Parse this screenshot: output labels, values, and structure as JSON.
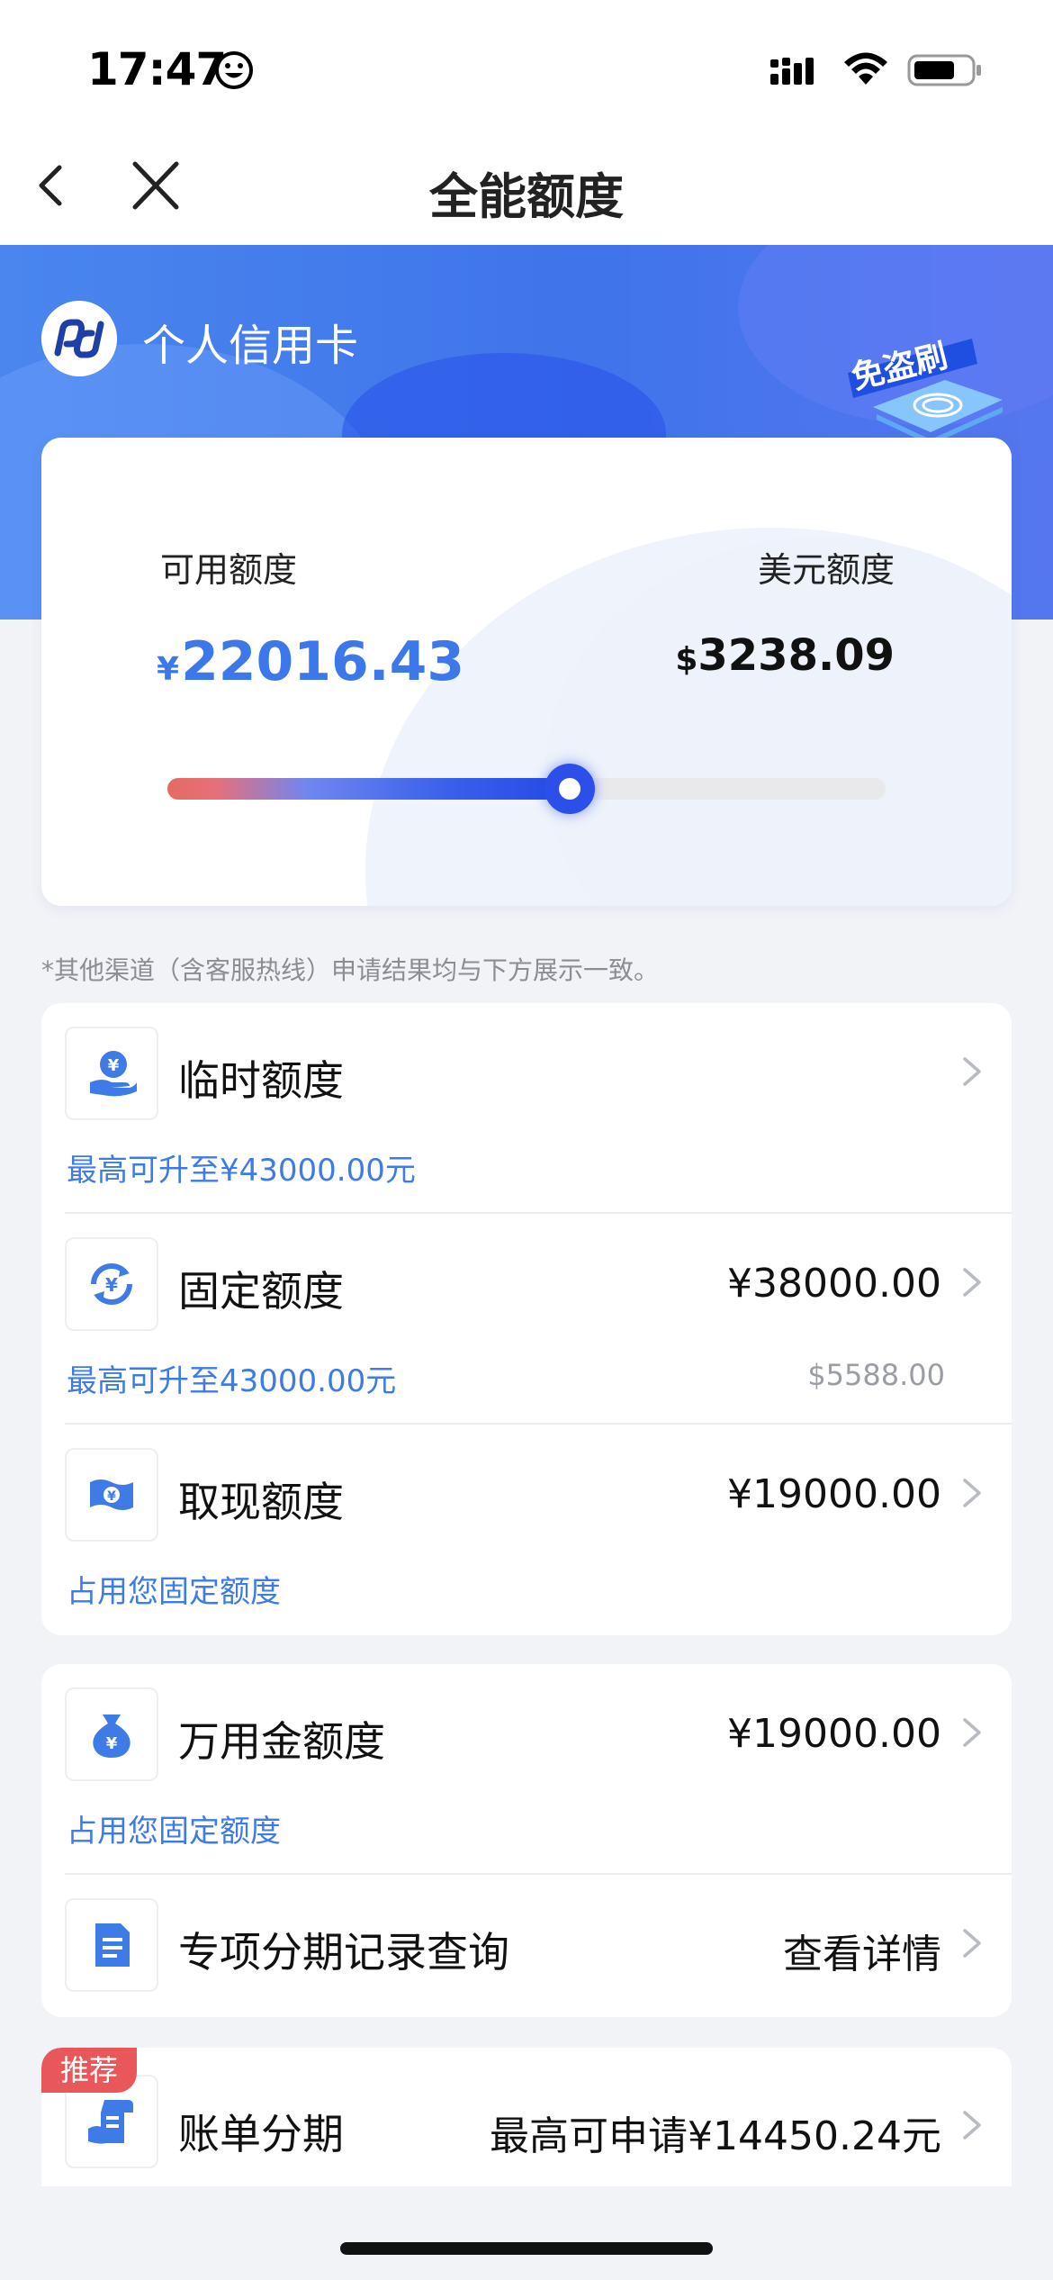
{
  "status_bar": {
    "time": "17:47"
  },
  "nav": {
    "title": "全能额度"
  },
  "hero": {
    "card_name": "个人信用卡",
    "badge_text": "免盗刷"
  },
  "quota": {
    "available_label": "可用额度",
    "available_currency": "¥",
    "available_value": "22016.43",
    "usd_label": "美元额度",
    "usd_currency": "$",
    "usd_value": "3238.09",
    "usage_fraction": 0.56
  },
  "disclaimer": "*其他渠道（含客服热线）申请结果均与下方展示一致。",
  "rows": [
    {
      "title": "临时额度",
      "value": "",
      "sub": "最高可升至¥43000.00元",
      "sub_right": ""
    },
    {
      "title": "固定额度",
      "value": "¥38000.00",
      "sub": "最高可升至43000.00元",
      "sub_right": "$5588.00"
    },
    {
      "title": "取现额度",
      "value": "¥19000.00",
      "sub": "占用您固定额度",
      "sub_right": ""
    },
    {
      "title": "万用金额度",
      "value": "¥19000.00",
      "sub": "占用您固定额度",
      "sub_right": ""
    },
    {
      "title": "专项分期记录查询",
      "value": "查看详情",
      "sub": "",
      "sub_right": ""
    },
    {
      "title": "账单分期",
      "value": "最高可申请¥14450.24元",
      "sub": "",
      "sub_right": "",
      "badge": "推荐"
    }
  ],
  "colors": {
    "accent": "#3f7be6",
    "hero": "#4a86ee",
    "badge": "#e8585a"
  },
  "icons": [
    "back-icon",
    "close-icon",
    "yen-hand-icon",
    "yen-cycle-icon",
    "cash-bill-icon",
    "money-bag-icon",
    "document-icon",
    "bill-installment-icon",
    "chevron-right-icon"
  ]
}
